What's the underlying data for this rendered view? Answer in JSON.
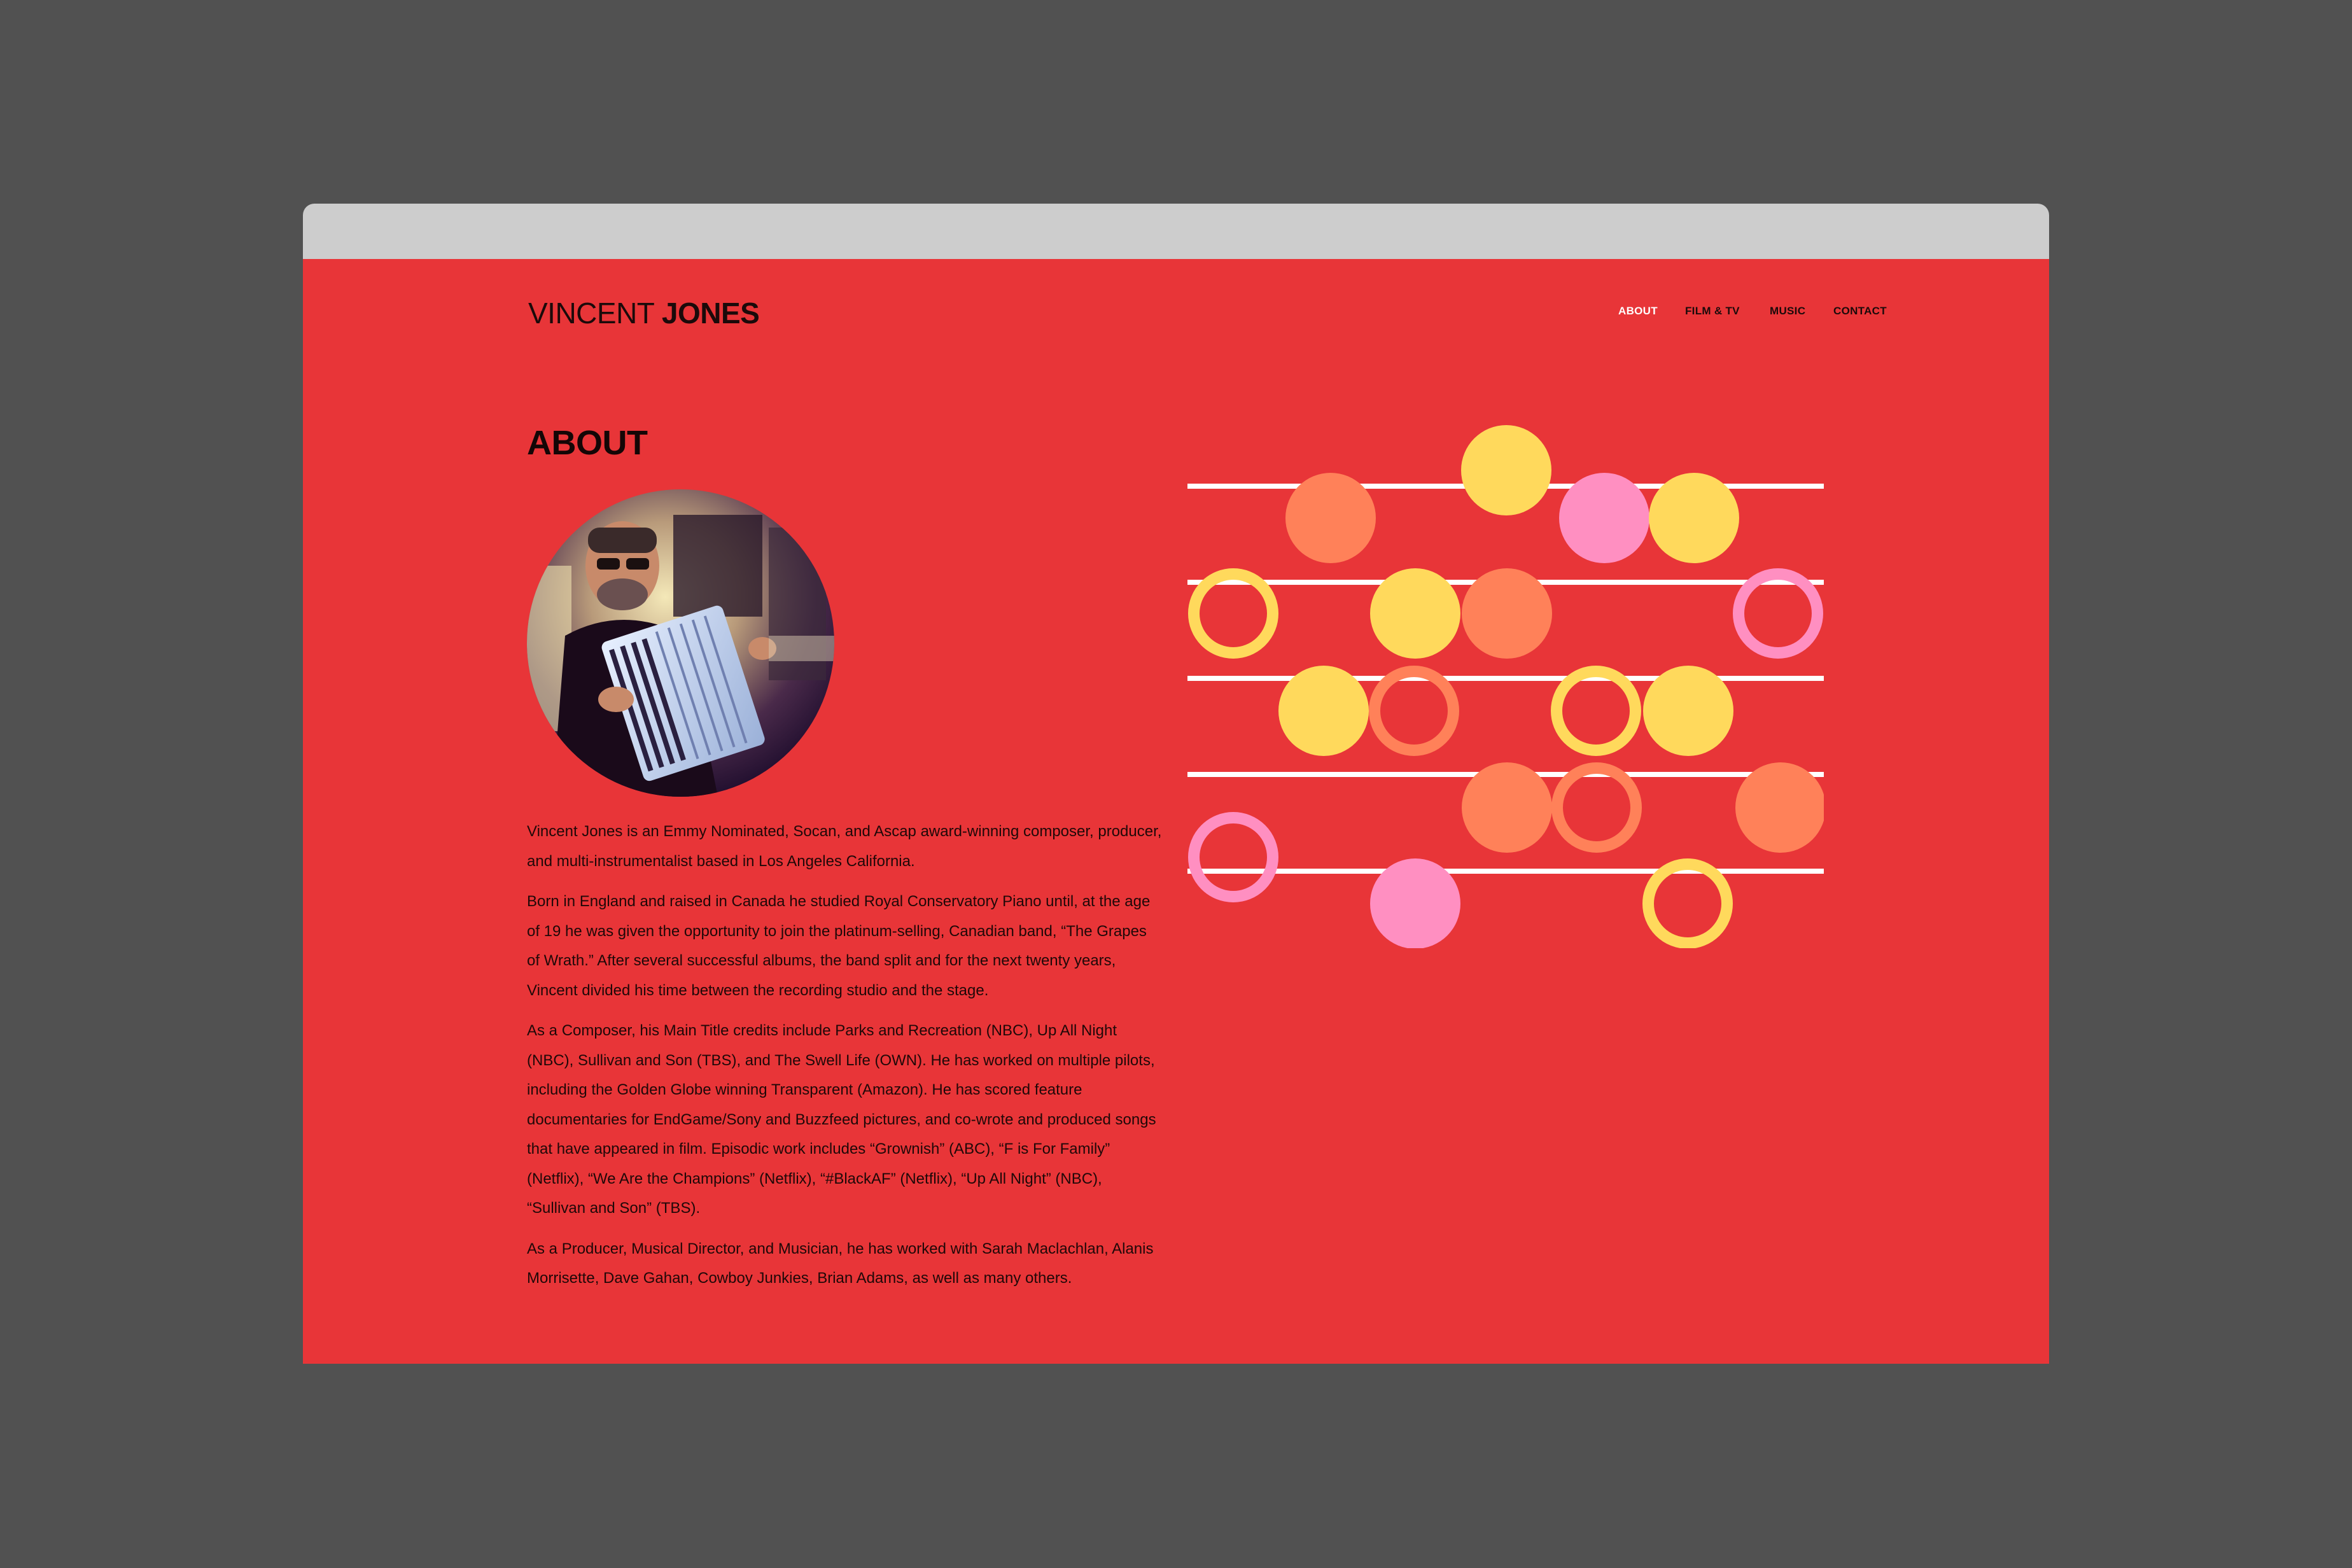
{
  "site": {
    "logo_first": "VINCENT",
    "logo_last": "JONES",
    "colors": {
      "page_background": "#e83538",
      "outer_background": "#515151",
      "window_bar": "#cdcdcd",
      "yellow": "#ffd95c",
      "orange": "#ff8159",
      "pink": "#ff8fc1",
      "line": "#ffffff"
    }
  },
  "nav": {
    "items": [
      {
        "label": "ABOUT",
        "active": true
      },
      {
        "label": "FILM & TV",
        "active": false
      },
      {
        "label": "MUSIC",
        "active": false
      },
      {
        "label": "CONTACT",
        "active": false
      }
    ]
  },
  "about": {
    "heading": "ABOUT",
    "photo": "portrait of musician playing accordion",
    "paragraphs": [
      "Vincent Jones is an Emmy Nominated, Socan, and Ascap award-winning composer, producer, and multi-instrumentalist based in Los Angeles California.",
      "Born in England and raised in Canada he studied Royal Conservatory Piano until, at the age of 19 he was given the opportunity to join the platinum-selling, Canadian band, “The Grapes of Wrath.” After several successful albums, the band split and for the next twenty years, Vincent divided his time between the recording studio and the stage.",
      "As a Composer, his Main Title credits include Parks and Recreation (NBC), Up All Night (NBC), Sullivan and Son (TBS), and The Swell Life (OWN). He has worked on multiple pilots, including the Golden Globe winning Transparent (Amazon). He has scored feature documentaries for EndGame/Sony and Buzzfeed pictures, and co-wrote and produced songs that have appeared in film. Episodic work includes “Grownish” (ABC), “F is For Family” (Netflix), “We Are the Champions” (Netflix), “#BlackAF” (Netflix), “Up All Night” (NBC), “Sullivan and Son” (TBS).",
      "As a Producer, Musical Director, and Musician, he has worked with Sarah Maclachlan, Alanis Morrisette, Dave Gahan, Cowboy Junkies, Brian Adams, as well as many others."
    ]
  }
}
